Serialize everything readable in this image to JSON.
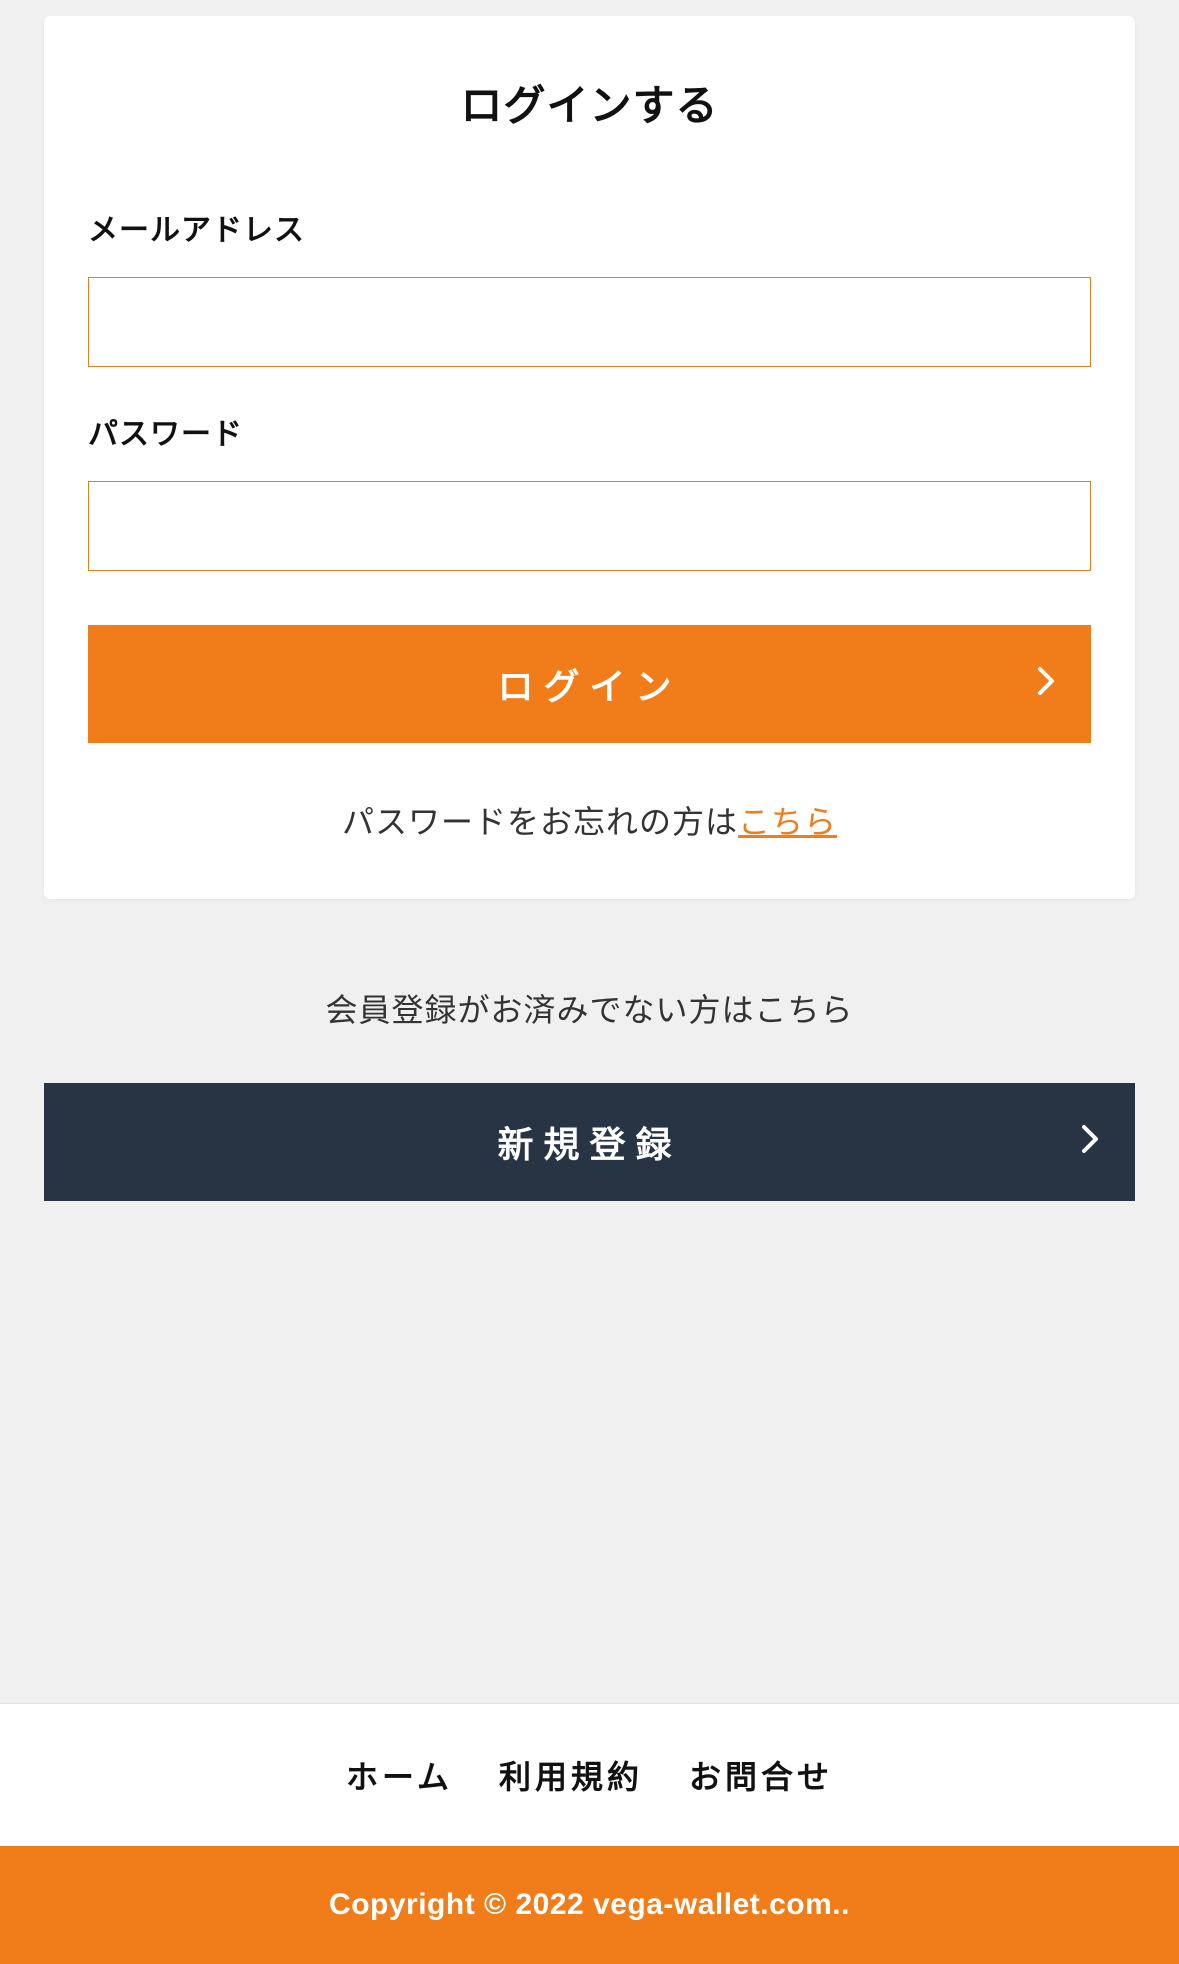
{
  "login": {
    "title": "ログインする",
    "email_label": "メールアドレス",
    "password_label": "パスワード",
    "submit_label": "ログイン",
    "forgot_prefix": "パスワードをお忘れの方は",
    "forgot_link": "こちら"
  },
  "register": {
    "prompt": "会員登録がお済みでない方はこちら",
    "button_label": "新規登録"
  },
  "footer": {
    "links": {
      "home": "ホーム",
      "terms": "利用規約",
      "contact": "お問合せ"
    },
    "copyright": "Copyright © 2022 vega-wallet.com.."
  }
}
